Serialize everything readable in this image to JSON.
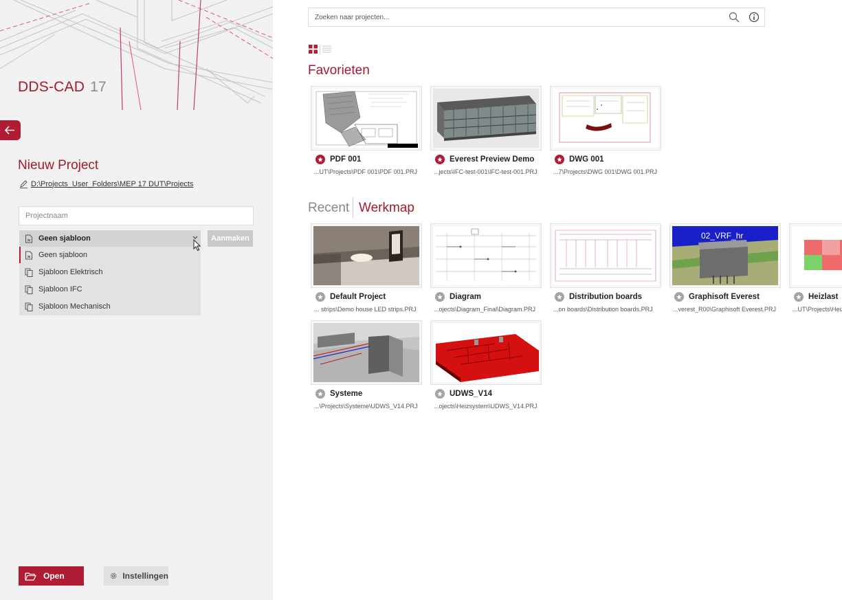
{
  "app": {
    "name": "DDS-CAD",
    "version": "17"
  },
  "new_project": {
    "title": "Nieuw Project",
    "path": "D:\\Projects_User_Folders\\MEP 17 DUT\\Projects",
    "name_placeholder": "Projectnaam",
    "create_label": "Aanmaken",
    "selected_template": "Geen sjabloon",
    "templates": [
      "Geen sjabloon",
      "Sjabloon Elektrisch",
      "Sjabloon IFC",
      "Sjabloon Mechanisch"
    ]
  },
  "footer": {
    "open_label": "Open",
    "settings_label": "Instellingen"
  },
  "search": {
    "placeholder": "Zoeken naar projecten..."
  },
  "favorites": {
    "title": "Favorieten",
    "items": [
      {
        "name": "PDF 001",
        "path": "...UT\\Projects\\PDF 001\\PDF 001.PRJ"
      },
      {
        "name": "Everest Preview Demo",
        "path": "...jects\\IFC-test-001\\IFC-test-001.PRJ"
      },
      {
        "name": "DWG 001",
        "path": "...7\\Projects\\DWG 001\\DWG 001.PRJ"
      }
    ]
  },
  "tabs": {
    "recent": "Recent",
    "werkmap": "Werkmap"
  },
  "werkmap": {
    "items": [
      {
        "name": "Default Project",
        "path": "... strips\\Demo house LED strips.PRJ"
      },
      {
        "name": "Diagram",
        "path": "...ojects\\Diagram_Final\\Diagram.PRJ"
      },
      {
        "name": "Distribution boards",
        "path": "...on boards\\Distribution boards.PRJ"
      },
      {
        "name": "Graphisoft Everest",
        "path": "...verest_R00\\Graphisoft Everest.PRJ"
      },
      {
        "name": "Heizlast",
        "path": "...UT\\Projects\\Heiz"
      },
      {
        "name": "Systeme",
        "path": "...\\Projects\\Systeme\\UDWS_V14.PRJ"
      },
      {
        "name": "UDWS_V14",
        "path": "...ojects\\Heizsystem\\UDWS_V14.PRJ"
      }
    ],
    "thumb_label_vrf": "02_VRF_hr"
  },
  "colors": {
    "accent": "#b01c33",
    "title": "#a3192e",
    "panel": "#f1f1f1"
  }
}
